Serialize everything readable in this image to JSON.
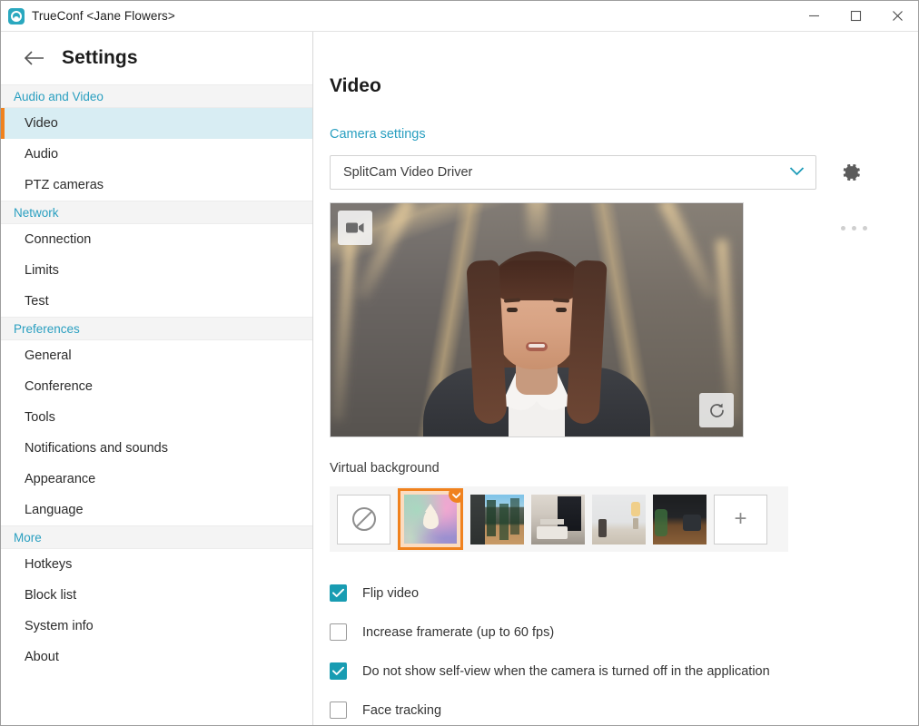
{
  "window": {
    "app_title": "TrueConf <Jane Flowers>",
    "app_icon": "trueconf-logo-icon",
    "controls": {
      "minimize": "minimize-icon",
      "maximize": "maximize-icon",
      "close": "close-icon"
    }
  },
  "sidebar": {
    "header_title": "Settings",
    "back_icon": "back-arrow-icon",
    "groups": [
      {
        "label": "Audio and Video",
        "items": [
          {
            "label": "Video",
            "selected": true
          },
          {
            "label": "Audio",
            "selected": false
          },
          {
            "label": "PTZ cameras",
            "selected": false
          }
        ]
      },
      {
        "label": "Network",
        "items": [
          {
            "label": "Connection",
            "selected": false
          },
          {
            "label": "Limits",
            "selected": false
          },
          {
            "label": "Test",
            "selected": false
          }
        ]
      },
      {
        "label": "Preferences",
        "items": [
          {
            "label": "General",
            "selected": false
          },
          {
            "label": "Conference",
            "selected": false
          },
          {
            "label": "Tools",
            "selected": false
          },
          {
            "label": "Notifications and sounds",
            "selected": false
          },
          {
            "label": "Appearance",
            "selected": false
          },
          {
            "label": "Language",
            "selected": false
          }
        ]
      },
      {
        "label": "More",
        "items": [
          {
            "label": "Hotkeys",
            "selected": false
          },
          {
            "label": "Block list",
            "selected": false
          },
          {
            "label": "System info",
            "selected": false
          },
          {
            "label": "About",
            "selected": false
          }
        ]
      }
    ]
  },
  "main": {
    "page_title": "Video",
    "camera_settings_label": "Camera settings",
    "camera_select": {
      "value": "SplitCam Video Driver",
      "chevron_icon": "chevron-down-icon",
      "options": [
        "SplitCam Video Driver"
      ]
    },
    "gear_icon": "gear-icon",
    "more_icon": "more-options-dots-icon",
    "preview": {
      "camera_badge_icon": "video-camera-icon",
      "refresh_badge_icon": "refresh-icon"
    },
    "virtual_background": {
      "label": "Virtual background",
      "items": [
        {
          "name": "none",
          "type": "icon",
          "icon": "no-background-icon",
          "selected": false
        },
        {
          "name": "blur",
          "type": "blur",
          "icon": "blur-drop-icon",
          "selected": true
        },
        {
          "name": "balcony",
          "type": "photo",
          "selected": false
        },
        {
          "name": "modern-office",
          "type": "photo",
          "selected": false
        },
        {
          "name": "white-room",
          "type": "photo",
          "selected": false
        },
        {
          "name": "dark-lounge",
          "type": "photo",
          "selected": false
        },
        {
          "name": "add",
          "type": "icon",
          "icon": "plus-icon",
          "selected": false
        }
      ],
      "add_label": "+",
      "selected_check_icon": "check-icon"
    },
    "options": [
      {
        "label": "Flip video",
        "checked": true
      },
      {
        "label": "Increase framerate (up to 60 fps)",
        "checked": false
      },
      {
        "label": "Do not show self-view when the camera is turned off in the application",
        "checked": true
      },
      {
        "label": "Face tracking",
        "checked": false
      }
    ]
  },
  "colors": {
    "accent_teal": "#2a9fc0",
    "accent_orange": "#f0821e",
    "checkbox_checked": "#189cb2",
    "selected_row_bg": "#d8edf3"
  }
}
